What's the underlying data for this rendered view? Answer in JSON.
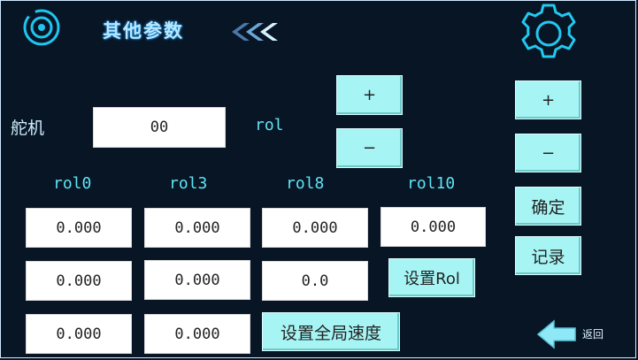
{
  "header": {
    "title": "其他参数",
    "logo_icon": "orbit-icon",
    "arrows_icon": "triple-chevron-left-icon",
    "settings_icon": "gear-icon"
  },
  "servo": {
    "label": "舵机",
    "value": "00"
  },
  "rol_label": "rol",
  "columns": [
    "rol0",
    "rol3",
    "rol8",
    "rol10"
  ],
  "grid": {
    "row1": [
      "0.000",
      "0.000",
      "0.000",
      "0.000"
    ],
    "row2": [
      "0.000",
      "0.000",
      "0.0"
    ],
    "row3": [
      "0.000",
      "0.000"
    ]
  },
  "buttons": {
    "rol_plus": "+",
    "rol_minus": "−",
    "side_plus": "+",
    "side_minus": "−",
    "confirm": "确定",
    "record": "记录",
    "set_rol": "设置Rol",
    "set_global_speed": "设置全局速度"
  },
  "back": {
    "label": "返回",
    "icon": "arrow-left-icon"
  },
  "colors": {
    "background": "#081524",
    "button": "#a7f4f4",
    "label": "#5fe3f5",
    "icon": "#22c8f0"
  }
}
